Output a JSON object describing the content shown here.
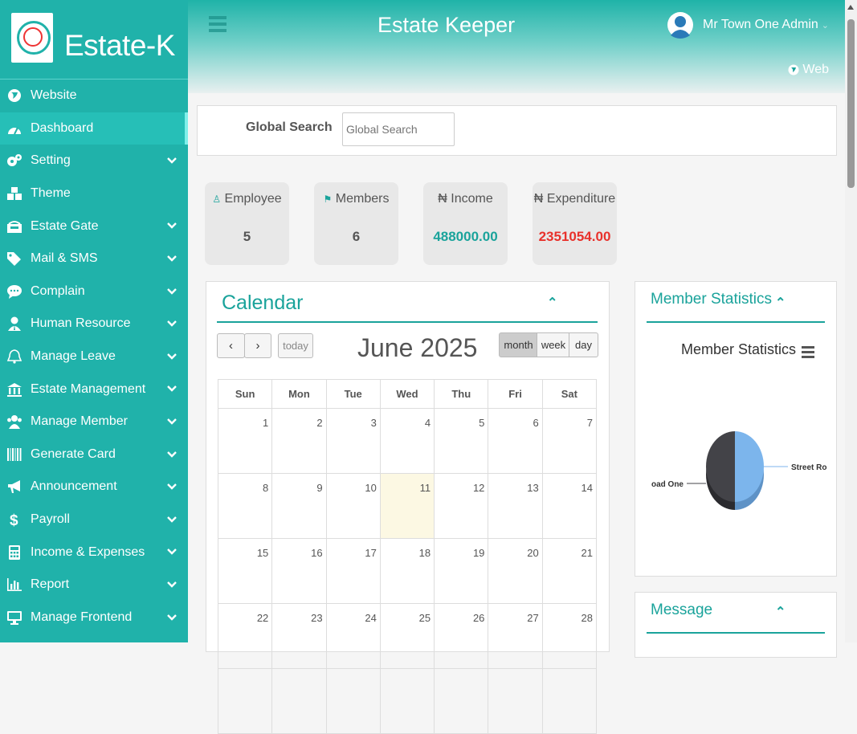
{
  "brand": {
    "name": "Estate-K",
    "logo_text": "Estate Keeper"
  },
  "sidebar": {
    "items": [
      {
        "label": "Website",
        "icon": "globe-icon",
        "has_submenu": false
      },
      {
        "label": "Dashboard",
        "icon": "dashboard-icon",
        "has_submenu": false,
        "active": true
      },
      {
        "label": "Setting",
        "icon": "cogs-icon",
        "has_submenu": true
      },
      {
        "label": "Theme",
        "icon": "cubes-icon",
        "has_submenu": false
      },
      {
        "label": "Estate Gate",
        "icon": "gate-icon",
        "has_submenu": true
      },
      {
        "label": "Mail & SMS",
        "icon": "tags-icon",
        "has_submenu": true
      },
      {
        "label": "Complain",
        "icon": "comment-icon",
        "has_submenu": true
      },
      {
        "label": "Human Resource",
        "icon": "user-tie-icon",
        "has_submenu": true
      },
      {
        "label": "Manage Leave",
        "icon": "bell-icon",
        "has_submenu": true
      },
      {
        "label": "Estate Management",
        "icon": "bank-icon",
        "has_submenu": true
      },
      {
        "label": "Manage Member",
        "icon": "users-icon",
        "has_submenu": true
      },
      {
        "label": "Generate Card",
        "icon": "barcode-icon",
        "has_submenu": true
      },
      {
        "label": "Announcement",
        "icon": "bullhorn-icon",
        "has_submenu": true
      },
      {
        "label": "Payroll",
        "icon": "dollar-icon",
        "has_submenu": true
      },
      {
        "label": "Income & Expenses",
        "icon": "calculator-icon",
        "has_submenu": true
      },
      {
        "label": "Report",
        "icon": "bar-chart-icon",
        "has_submenu": true
      },
      {
        "label": "Manage Frontend",
        "icon": "desktop-icon",
        "has_submenu": true
      }
    ]
  },
  "header": {
    "title": "Estate Keeper",
    "user_name": "Mr Town One Admin",
    "web_link": "Web"
  },
  "search": {
    "label": "Global Search",
    "placeholder": "Global Search",
    "value": ""
  },
  "stats": [
    {
      "title": "Employee",
      "icon": "user-tie-icon",
      "value": "5",
      "color": "#555555"
    },
    {
      "title": "Members",
      "icon": "users-icon",
      "value": "6",
      "color": "#555555"
    },
    {
      "title": "Income",
      "icon": "naira-icon",
      "prefix": "₦",
      "value": "488000.00",
      "color": "#1aa39b"
    },
    {
      "title": "Expenditure",
      "icon": "naira-icon",
      "prefix": "₦",
      "value": "2351054.00",
      "color": "#e8312b"
    }
  ],
  "calendar": {
    "title": "Calendar",
    "month_label": "June 2025",
    "today_label": "today",
    "view_buttons": [
      "month",
      "week",
      "day"
    ],
    "active_view": "month",
    "weekdays": [
      "Sun",
      "Mon",
      "Tue",
      "Wed",
      "Thu",
      "Fri",
      "Sat"
    ],
    "weeks": [
      [
        "1",
        "2",
        "3",
        "4",
        "5",
        "6",
        "7"
      ],
      [
        "8",
        "9",
        "10",
        "11",
        "12",
        "13",
        "14"
      ],
      [
        "15",
        "16",
        "17",
        "18",
        "19",
        "20",
        "21"
      ],
      [
        "22",
        "23",
        "24",
        "25",
        "26",
        "27",
        "28"
      ],
      [
        "",
        "",
        "",
        "",
        "",
        "",
        ""
      ]
    ],
    "today_date": "11"
  },
  "member_statistics": {
    "panel_title": "Member Statistics",
    "chart_data": {
      "type": "pie",
      "title": "Member Statistics",
      "labels": [
        "Street Ro",
        "oad One"
      ],
      "values": [
        50,
        50
      ],
      "colors": [
        "#7cb5ec",
        "#434348"
      ]
    }
  },
  "message": {
    "panel_title": "Message"
  },
  "colors": {
    "accent": "#20b2aa",
    "accent_dark": "#1aa39b",
    "income": "#1aa39b",
    "expenditure": "#e8312b"
  }
}
